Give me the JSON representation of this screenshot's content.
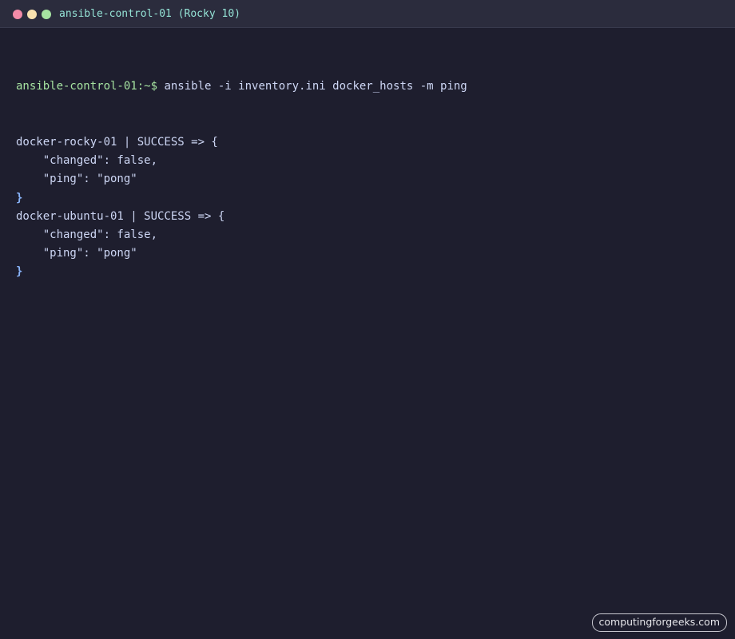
{
  "window": {
    "title": "ansible-control-01 (Rocky 10)",
    "controls": {
      "close_color": "#f38ba8",
      "minimize_color": "#f9e2af",
      "maximize_color": "#a6e3a1"
    }
  },
  "terminal": {
    "prompt": "ansible-control-01:~$",
    "command": " ansible -i inventory.ini docker_hosts -m ping",
    "output": [
      {
        "text": "docker-rocky-01 | SUCCESS => {",
        "kind": "text"
      },
      {
        "text": "    \"changed\": false,",
        "kind": "text"
      },
      {
        "text": "    \"ping\": \"pong\"",
        "kind": "text"
      },
      {
        "text": "}",
        "kind": "brace"
      },
      {
        "text": "docker-ubuntu-01 | SUCCESS => {",
        "kind": "text"
      },
      {
        "text": "    \"changed\": false,",
        "kind": "text"
      },
      {
        "text": "    \"ping\": \"pong\"",
        "kind": "text"
      },
      {
        "text": "}",
        "kind": "brace"
      }
    ]
  },
  "watermark": {
    "text": "computingforgeeks.com"
  },
  "colors": {
    "background": "#1e1e2e",
    "titlebar": "#2b2c3d",
    "title_text": "#94e2d5",
    "prompt": "#a6e3a1",
    "text": "#cdd6f4",
    "brace": "#89b4fa",
    "watermark_text": "#e6e6ea"
  }
}
